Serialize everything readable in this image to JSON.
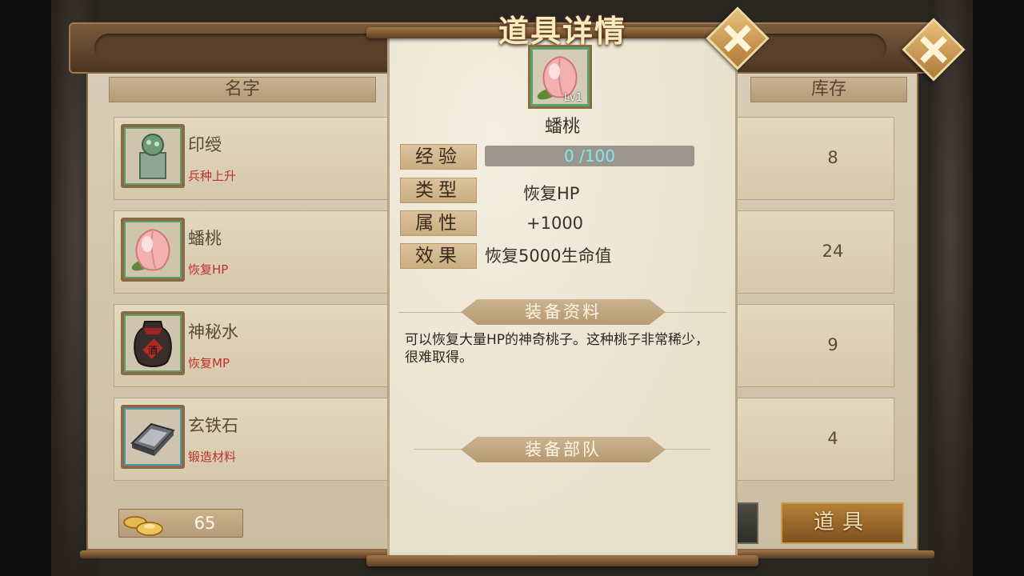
{
  "back_panel": {
    "columns": {
      "name": "名字",
      "stock": "库存"
    },
    "items": [
      {
        "name": "印绶",
        "desc": "兵种上升",
        "stock": "8",
        "icon": "jade-seal-icon"
      },
      {
        "name": "蟠桃",
        "desc": "恢复HP",
        "stock": "24",
        "icon": "peach-icon"
      },
      {
        "name": "神秘水",
        "desc": "恢复MP",
        "stock": "9",
        "icon": "wine-jar-icon"
      },
      {
        "name": "玄铁石",
        "desc": "锻造材料",
        "stock": "4",
        "icon": "iron-ingot-icon"
      }
    ],
    "gold": "65",
    "tab_label": "道具"
  },
  "detail": {
    "title": "道具详情",
    "item_name": "蟠桃",
    "level": "Lv1",
    "exp_label": "经验",
    "exp_text": "0 /100",
    "exp_current": 0,
    "exp_max": 100,
    "type_label": "类型",
    "type_value": "恢复HP",
    "attr_label": "属性",
    "attr_value": "+1000",
    "effect_label": "效果",
    "effect_value": "恢复5000生命值",
    "info_banner": "装备资料",
    "description": "可以恢复大量HP的神奇桃子。这种桃子非常稀少，很难取得。",
    "troops_banner": "装备部队"
  },
  "colors": {
    "red_desc": "#c03030",
    "exp_text": "#7fe8f2",
    "gold_tab": "#b57f35"
  }
}
